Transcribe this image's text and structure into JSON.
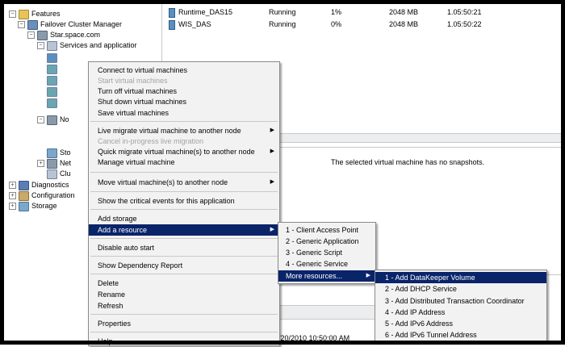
{
  "tree": {
    "features": "Features",
    "failover_cluster_manager": "Failover Cluster Manager",
    "cluster_name": "Star.space.com",
    "services_and_applications": "Services and applicatior",
    "nodes_partial": "No",
    "storage_partial": "Sto",
    "networks_partial": "Net",
    "cluster_events_partial": "Clu",
    "diagnostics": "Diagnostics",
    "configuration": "Configuration",
    "storage": "Storage"
  },
  "vm_list": [
    {
      "name": "Runtime_DAS15",
      "status": "Running",
      "cpu": "1%",
      "memory": "2048 MB",
      "uptime": "1.05:50:21"
    },
    {
      "name": "WIS_DAS",
      "status": "Running",
      "cpu": "0%",
      "memory": "2048 MB",
      "uptime": "1.05:50:22"
    }
  ],
  "snapshot_message": "The selected virtual machine has no snapshots.",
  "timestamp": "/20/2010 10:50:00 AM",
  "context_menu": [
    {
      "label": "Connect to virtual machines",
      "disabled": false
    },
    {
      "label": "Start virtual machines",
      "disabled": true
    },
    {
      "label": "Turn off virtual machines",
      "disabled": false
    },
    {
      "label": "Shut down virtual machines",
      "disabled": false
    },
    {
      "label": "Save virtual machines",
      "disabled": false
    },
    {
      "label": "Live migrate virtual machine to another node",
      "disabled": false,
      "submenu": true
    },
    {
      "label": "Cancel in-progress live migration",
      "disabled": true
    },
    {
      "label": "Quick migrate virtual machine(s) to another node",
      "disabled": false,
      "submenu": true
    },
    {
      "label": "Manage virtual machine",
      "disabled": false
    },
    {
      "label": "Move virtual machine(s) to another node",
      "disabled": false,
      "submenu": true
    },
    {
      "label": "Show the critical events for this application",
      "disabled": false
    },
    {
      "label": "Add storage",
      "disabled": false
    },
    {
      "label": "Add a resource",
      "disabled": false,
      "submenu": true,
      "selected": true
    },
    {
      "label": "Disable auto start",
      "disabled": false
    },
    {
      "label": "Show Dependency Report",
      "disabled": false
    },
    {
      "label": "Delete",
      "disabled": false
    },
    {
      "label": "Rename",
      "disabled": false
    },
    {
      "label": "Refresh",
      "disabled": false
    },
    {
      "label": "Properties",
      "disabled": false
    },
    {
      "label": "Help",
      "disabled": false
    }
  ],
  "resource_menu": [
    {
      "label": "1 - Client Access Point"
    },
    {
      "label": "2 - Generic Application"
    },
    {
      "label": "3 - Generic Script"
    },
    {
      "label": "4 - Generic Service"
    },
    {
      "label": "More resources...",
      "selected": true,
      "submenu": true
    }
  ],
  "more_resources_menu": [
    {
      "label": "1 - Add DataKeeper Volume",
      "selected": true
    },
    {
      "label": "2 - Add DHCP Service"
    },
    {
      "label": "3 - Add Distributed Transaction Coordinator"
    },
    {
      "label": "4 - Add IP Address"
    },
    {
      "label": "5 - Add IPv6 Address"
    },
    {
      "label": "6 - Add IPv6 Tunnel Address"
    }
  ],
  "colors": {
    "menu_highlight": "#0a246a",
    "menu_background": "#f2f2f2",
    "disabled_text": "#a3a3a3"
  }
}
